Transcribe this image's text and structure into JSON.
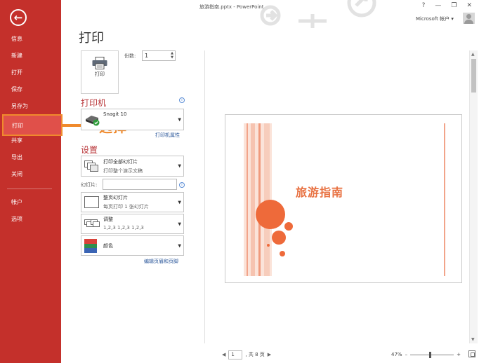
{
  "window": {
    "title": "旅游指南.pptx - PowerPoint",
    "controls": [
      "?",
      "—",
      "❐",
      "✕"
    ],
    "account": "Microsoft 帐户"
  },
  "sidebar": {
    "back_icon": "back-arrow-icon",
    "items": [
      {
        "label": "信息"
      },
      {
        "label": "新建"
      },
      {
        "label": "打开"
      },
      {
        "label": "保存"
      },
      {
        "label": "另存为"
      },
      {
        "label": "打印",
        "active": true
      },
      {
        "label": "共享"
      },
      {
        "label": "导出"
      },
      {
        "label": "关闭"
      },
      {
        "label": "帐户"
      },
      {
        "label": "选项"
      }
    ]
  },
  "annotation": {
    "text": "选择",
    "color": "#f08a2c"
  },
  "print_panel": {
    "title": "打印",
    "print_button": {
      "label": "打印",
      "icon": "printer-icon"
    },
    "copies_label": "份数:",
    "copies_value": "1",
    "printer_heading": "打印机",
    "printer_name": "Snagit 10",
    "printer_properties_link": "打印机属性",
    "settings_heading": "设置",
    "print_what": {
      "main": "打印全部幻灯片",
      "sub": "打印整个演示文稿"
    },
    "slides_label": "幻灯片:",
    "slides_value": "",
    "layout": {
      "main": "整页幻灯片",
      "sub": "每页打印 1 张幻灯片"
    },
    "collate": {
      "main": "调整",
      "sub": "1,2,3    1,2,3    1,2,3"
    },
    "color": {
      "main": "颜色"
    },
    "header_footer_link": "编辑页眉和页脚"
  },
  "preview": {
    "slide_title": "旅游指南",
    "current_page": "1",
    "page_total_text": ", 共 8 页",
    "zoom": "47%",
    "zoom_fraction": 0.47
  },
  "colors": {
    "sidebar": "#c4302b",
    "accent": "#b9373a",
    "annotation": "#f08a2c",
    "slide_circle": "#ee6a3a",
    "link": "#2b579a"
  }
}
